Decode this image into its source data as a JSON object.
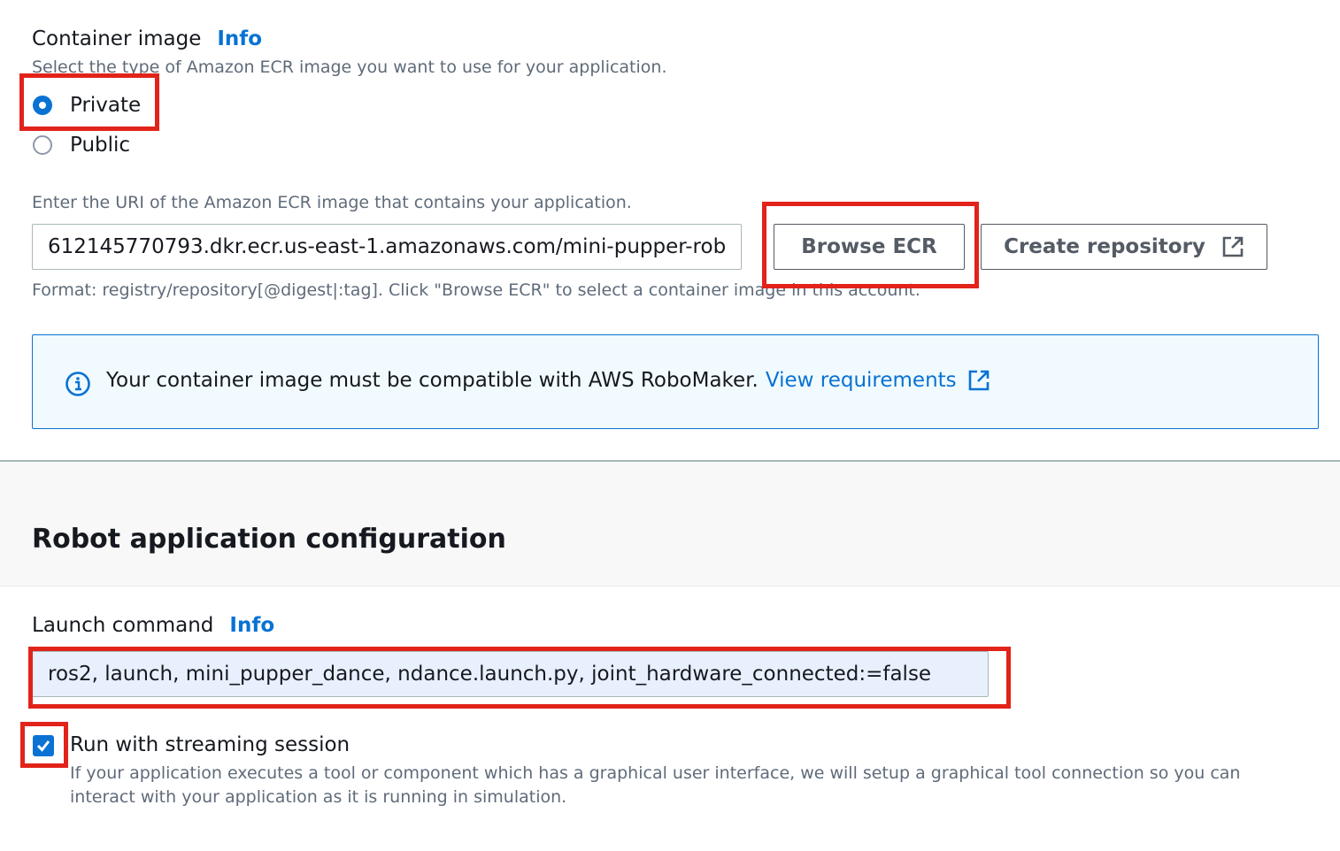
{
  "container_image": {
    "label": "Container image",
    "info_link": "Info",
    "description": "Select the type of Amazon ECR image you want to use for your application.",
    "options": [
      {
        "label": "Private",
        "selected": true
      },
      {
        "label": "Public",
        "selected": false
      }
    ]
  },
  "uri": {
    "description": "Enter the URI of the Amazon ECR image that contains your application.",
    "value": "612145770793.dkr.ecr.us-east-1.amazonaws.com/mini-pupper-rob",
    "browse_button": "Browse ECR",
    "create_button": "Create repository",
    "format_hint": "Format: registry/repository[@digest|:tag]. Click \"Browse ECR\" to select a container image in this account."
  },
  "alert": {
    "text": "Your container image must be compatible with AWS RoboMaker.",
    "link": "View requirements"
  },
  "robot_config": {
    "heading": "Robot application configuration"
  },
  "launch": {
    "label": "Launch command",
    "info_link": "Info",
    "value": "ros2, launch, mini_pupper_dance, ndance.launch.py, joint_hardware_connected:=false"
  },
  "streaming": {
    "label": "Run with streaming session",
    "checked": true,
    "description_line1": "If your application executes a tool or component which has a graphical user interface, we will setup a graphical tool connection so you can",
    "description_line2": "interact with your application as it is running in simulation."
  },
  "colors": {
    "accent": "#0972d3",
    "highlight": "#e2231a",
    "alert_bg": "#f1faff"
  }
}
